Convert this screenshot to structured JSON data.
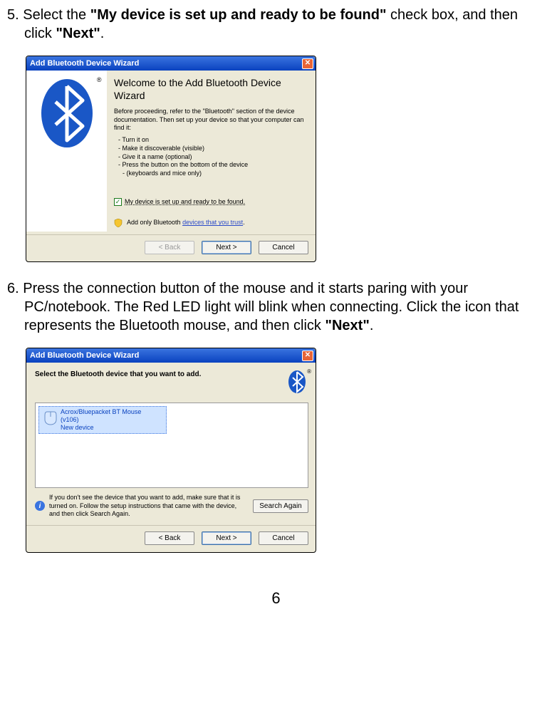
{
  "step5": {
    "prefix": "5. Select the ",
    "bold1": "\"My device is set up and ready to be found\"",
    "mid": " check box, and then click ",
    "bold2": "\"Next\"",
    "suffix": "."
  },
  "dialog1": {
    "title": "Add Bluetooth Device Wizard",
    "welcome": "Welcome to the Add Bluetooth Device Wizard",
    "instr": "Before proceeding, refer to the \"Bluetooth\" section of the device documentation. Then set up your device so that your computer can find it:",
    "b1": "Turn it on",
    "b2": "Make it discoverable (visible)",
    "b3": "Give it a name (optional)",
    "b4": "Press the button on the bottom of the device",
    "b4sub": "(keyboards and mice only)",
    "checkbox": "My device is set up and ready to be found.",
    "trust_pre": "Add only Bluetooth ",
    "trust_link": "devices that you trust",
    "trust_post": ".",
    "back": "< Back",
    "next": "Next >",
    "cancel": "Cancel"
  },
  "step6": {
    "prefix": "6. Press the connection button of the mouse and it starts paring with your PC/notebook. The Red LED light will blink when connecting. Click the icon that represents the Bluetooth mouse, and then click ",
    "bold": "\"Next\"",
    "suffix": "."
  },
  "dialog2": {
    "title": "Add Bluetooth Device Wizard",
    "heading": "Select the Bluetooth device that you want to add.",
    "dev_name": "Acrox/Bluepacket BT Mouse",
    "dev_line2": "(v106)",
    "dev_line3": "New device",
    "hint": "If you don't see the device that you want to add, make sure that it is turned on. Follow the setup instructions that came with the device, and then click Search Again.",
    "search": "Search Again",
    "back": "< Back",
    "next": "Next >",
    "cancel": "Cancel"
  },
  "page_number": "6"
}
